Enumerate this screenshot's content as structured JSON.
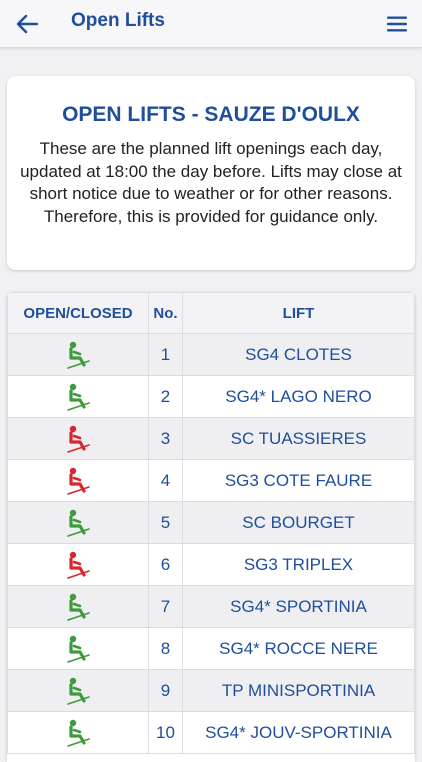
{
  "header": {
    "title": "Open Lifts",
    "back_icon": "arrow-left-icon",
    "menu_icon": "hamburger-menu-icon"
  },
  "info": {
    "title": "OPEN LIFTS - SAUZE D'OULX",
    "text": "These are the planned lift openings each day, updated at 18:00 the day before. Lifts may close at short notice due to weather or for other reasons. Therefore, this is provided for guidance only."
  },
  "table": {
    "headers": [
      "OPEN/CLOSED",
      "No.",
      "LIFT"
    ],
    "rows": [
      {
        "status": "open",
        "num": "1",
        "lift": "SG4 CLOTES"
      },
      {
        "status": "open",
        "num": "2",
        "lift": "SG4* LAGO NERO"
      },
      {
        "status": "closed",
        "num": "3",
        "lift": "SC TUASSIERES"
      },
      {
        "status": "closed",
        "num": "4",
        "lift": "SG3 COTE FAURE"
      },
      {
        "status": "open",
        "num": "5",
        "lift": "SC BOURGET"
      },
      {
        "status": "closed",
        "num": "6",
        "lift": "SG3 TRIPLEX"
      },
      {
        "status": "open",
        "num": "7",
        "lift": "SG4* SPORTINIA"
      },
      {
        "status": "open",
        "num": "8",
        "lift": "SG4* ROCCE NERE"
      },
      {
        "status": "open",
        "num": "9",
        "lift": "TP MINISPORTINIA"
      },
      {
        "status": "open",
        "num": "10",
        "lift": "SG4* JOUV-SPORTINIA"
      }
    ]
  },
  "colors": {
    "accent": "#1f4e9c",
    "open": "#3e9a3a",
    "closed": "#d8252e"
  },
  "icons": {
    "status": "chairlift-seat-icon"
  }
}
